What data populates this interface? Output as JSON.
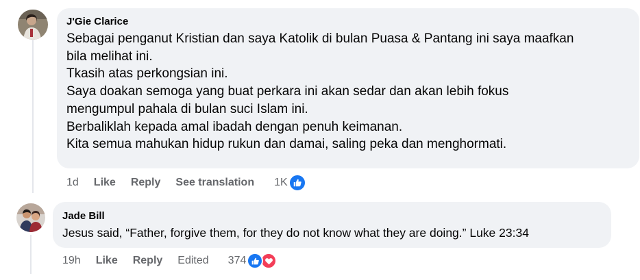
{
  "comments": [
    {
      "author": "J'Gie Clarice",
      "lines": [
        "Sebagai penganut Kristian dan saya Katolik di bulan Puasa & Pantang ini saya maafkan",
        "bila melihat ini.",
        "Tkasih atas perkongsian ini.",
        "Saya doakan semoga yang buat perkara ini akan sedar dan akan lebih fokus",
        "mengumpul pahala di bulan suci Islam ini.",
        "Berbaliklah kepada amal ibadah dengan penuh keimanan.",
        "Kita semua mahukan hidup rukun dan damai, saling peka dan menghormati."
      ],
      "time": "1d",
      "like_label": "Like",
      "reply_label": "Reply",
      "extra_label": "See translation",
      "reaction_count": "1K",
      "reactions": [
        "like-icon"
      ]
    },
    {
      "author": "Jade Bill",
      "lines": [
        "Jesus said, “Father, forgive them, for they do not know what they are doing.” Luke 23:34"
      ],
      "time": "19h",
      "like_label": "Like",
      "reply_label": "Reply",
      "extra_label": "Edited",
      "reaction_count": "374",
      "reactions": [
        "like-icon",
        "love-icon"
      ]
    }
  ],
  "colors": {
    "bubble": "#f0f2f5",
    "like_blue": "#1877f2",
    "love_red": "#f33e58",
    "meta_gray": "#65676b"
  }
}
